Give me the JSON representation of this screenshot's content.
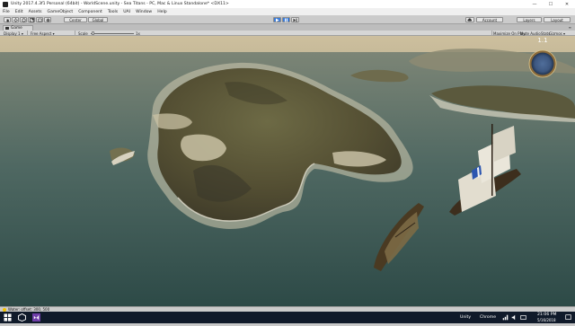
{
  "window": {
    "title": "Unity 2017.4.3f1 Personal (64bit) - WorldScene.unity - Sea Titans - PC, Mac & Linux Standalone* <DX11>",
    "minimize": "—",
    "maximize": "☐",
    "close": "✕"
  },
  "menu": [
    "File",
    "Edit",
    "Assets",
    "GameObject",
    "Component",
    "Tools",
    "UAI",
    "Window",
    "Help"
  ],
  "toolbar": {
    "pivot": "Center",
    "space": "Global",
    "play_icon": "play-icon",
    "pause_icon": "pause-icon",
    "step_icon": "step-icon",
    "account": "Account",
    "layers": "Layers",
    "layout": "Layout"
  },
  "game_tab": {
    "label": "Game",
    "menu": "≡"
  },
  "game_toolbar": {
    "display": "Display 1",
    "aspect": "Free Aspect",
    "scale_label": "Scale",
    "scale_value": "1x",
    "maximize_on_play": "Maximize On Play",
    "mute_audio": "Mute Audio",
    "stats": "Stats",
    "gizmos": "Gizmos"
  },
  "hud": {
    "compass_value": "1.1"
  },
  "status": {
    "text": "Water: offset: 300, 500"
  },
  "taskbar": {
    "user": "Unity",
    "browser": "Chrome",
    "time": "21:06 PM",
    "date": "5/16/2018"
  },
  "colors": {
    "sea": "#3e5a56",
    "sky": "#cdbf9e",
    "island": "#5c5838",
    "taskbar": "#101a2a",
    "play_active": "#3b7bd6"
  }
}
